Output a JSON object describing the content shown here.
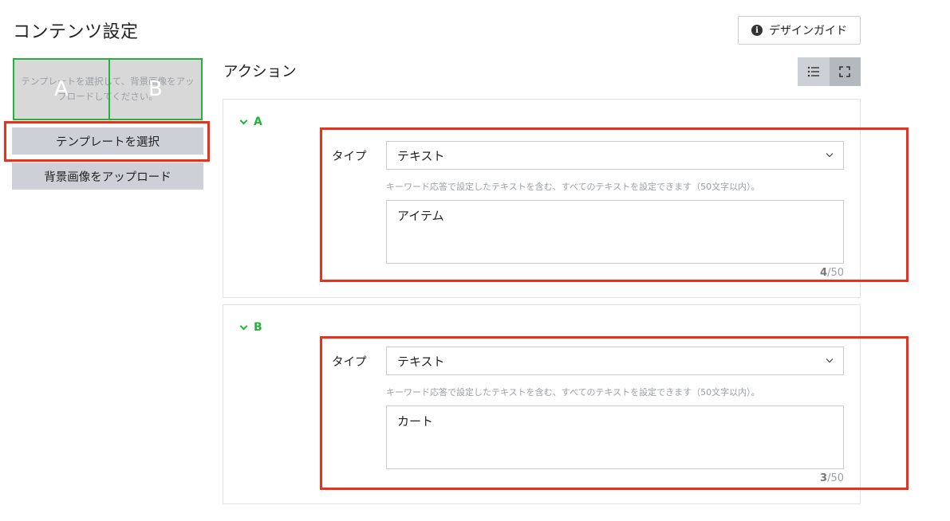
{
  "page": {
    "title": "コンテンツ設定",
    "design_guide_label": "デザインガイド",
    "design_guide_icon": "info-icon"
  },
  "preview": {
    "hint": "テンプレートを選択して、背景画像をアップロードしてください。",
    "areas": [
      "A",
      "B"
    ],
    "border_color": "#22b43a"
  },
  "sidebar": {
    "select_template_label": "テンプレートを選択",
    "upload_background_label": "背景画像をアップロード"
  },
  "actions": {
    "title": "アクション",
    "view_toggle": [
      "list-view-icon",
      "expand-view-icon"
    ],
    "items": [
      {
        "area": "A",
        "type_label": "タイプ",
        "type_value": "テキスト",
        "hint": "キーワード応答で設定したテキストを含む、すべてのテキストを設定できます（50文字以内）。",
        "text": "アイテム",
        "count": "4",
        "max": "/50"
      },
      {
        "area": "B",
        "type_label": "タイプ",
        "type_value": "テキスト",
        "hint": "キーワード応答で設定したテキストを含む、すべてのテキストを設定できます（50文字以内）。",
        "text": "カート",
        "count": "3",
        "max": "/50"
      }
    ]
  },
  "colors": {
    "accent": "#22b43a",
    "highlight": "#e8321e",
    "button": "#cdd1d7"
  }
}
